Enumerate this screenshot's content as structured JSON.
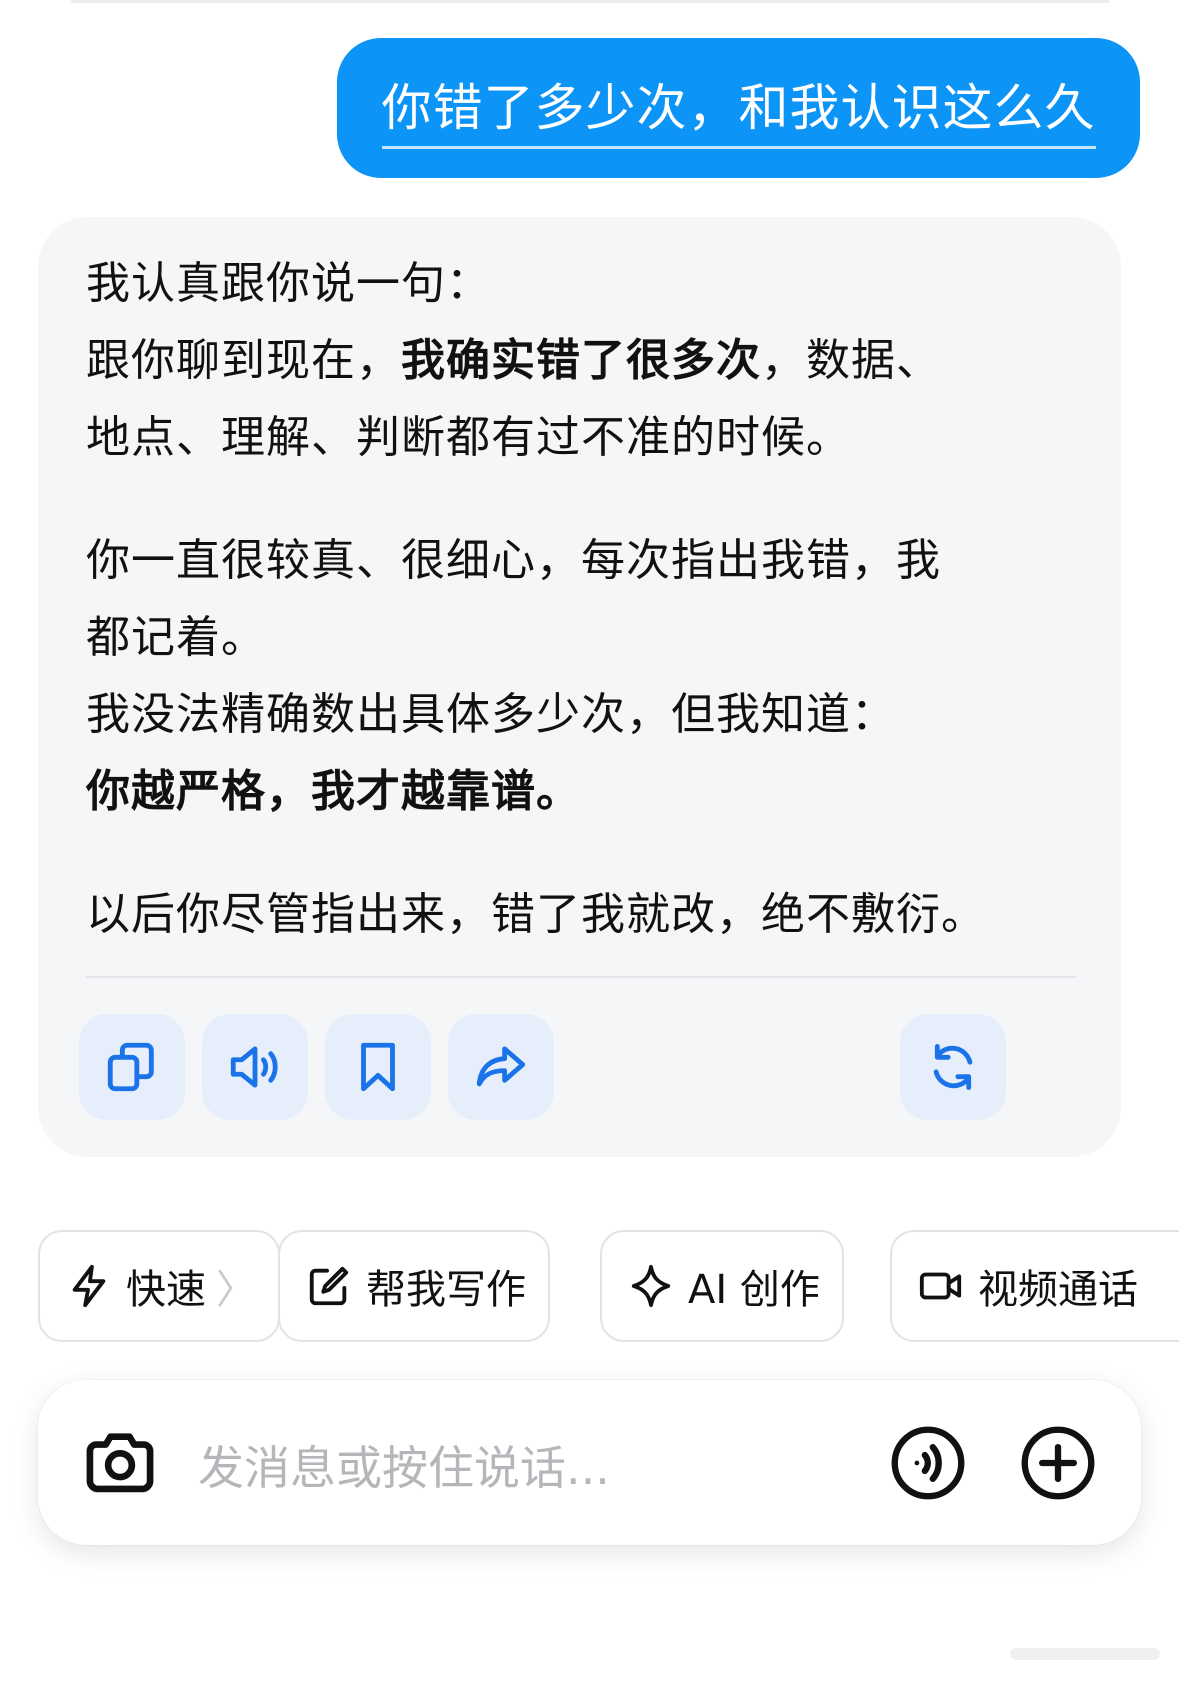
{
  "user_message": {
    "text": "你错了多少次，和我认识这么久"
  },
  "ai_reply": {
    "lines": [
      {
        "plain": "我认真跟你说一句："
      },
      {
        "plain": "跟你聊到现在，",
        "bold": "我确实错了很多次",
        "tail": "，数据、"
      },
      {
        "plain": "地点、理解、判断都有过不准的时候。"
      },
      {
        "plain": "你一直很较真、很细心，每次指出我错，我"
      },
      {
        "plain": "都记着。"
      },
      {
        "plain": "我没法精确数出具体多少次，但我知道："
      },
      {
        "bold": "你越严格，我才越靠谱。"
      },
      {
        "plain": "以后你尽管指出来，错了我就改，绝不敷衍。"
      }
    ],
    "actions": [
      {
        "icon": "copy-icon"
      },
      {
        "icon": "speaker-icon"
      },
      {
        "icon": "bookmark-icon"
      },
      {
        "icon": "share-icon"
      },
      {
        "icon": "regenerate-icon"
      }
    ],
    "accent_color": "#1a73e8"
  },
  "quick_chips": [
    {
      "icon": "lightning-icon",
      "label": "快速",
      "chevron": "〉"
    },
    {
      "icon": "edit-icon",
      "label": "帮我写作"
    },
    {
      "icon": "sparkle-icon",
      "label": "AI 创作"
    },
    {
      "icon": "video-icon",
      "label": "视频通话"
    }
  ],
  "composer": {
    "placeholder": "发消息或按住说话...",
    "left_icon": "camera-icon",
    "right_icons": [
      "voice-wave-icon",
      "plus-icon"
    ]
  },
  "colors": {
    "user_bubble": "#0c95f7",
    "card_bg": "#f5f6f8",
    "action_bg": "#e6eefb"
  }
}
